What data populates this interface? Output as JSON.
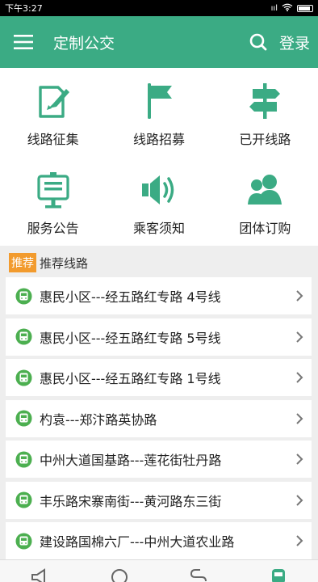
{
  "status_bar": {
    "time": "下午3:27",
    "signal_text": "ııl"
  },
  "app_bar": {
    "title": "定制公交",
    "login_label": "登录"
  },
  "grid": [
    {
      "label": "线路征集",
      "icon": "edit-document-icon"
    },
    {
      "label": "线路招募",
      "icon": "flag-icon"
    },
    {
      "label": "已开线路",
      "icon": "signpost-icon"
    },
    {
      "label": "服务公告",
      "icon": "notice-board-icon"
    },
    {
      "label": "乘客须知",
      "icon": "speaker-icon"
    },
    {
      "label": "团体订购",
      "icon": "group-users-icon"
    }
  ],
  "section": {
    "badge": "推荐",
    "title": "推荐线路"
  },
  "routes": [
    {
      "name": "惠民小区---经五路红专路 4号线"
    },
    {
      "name": "惠民小区---经五路红专路 5号线"
    },
    {
      "name": "惠民小区---经五路红专路 1号线"
    },
    {
      "name": "杓袁---郑汴路英协路"
    },
    {
      "name": "中州大道国基路---莲花街牡丹路"
    },
    {
      "name": "丰乐路宋寨南街---黄河路东三街"
    },
    {
      "name": "建设路国棉六厂---中州大道农业路"
    }
  ],
  "bottom_nav": [
    {
      "icon": "megaphone-icon"
    },
    {
      "icon": "search-circle-icon"
    },
    {
      "icon": "route-icon"
    },
    {
      "icon": "bus-icon"
    }
  ],
  "colors": {
    "primary": "#3bab84",
    "accent": "#f29b2e",
    "bus_green": "#4caf50"
  }
}
